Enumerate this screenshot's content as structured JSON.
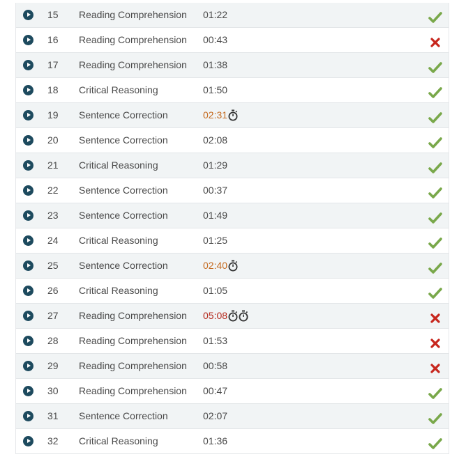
{
  "colors": {
    "correct": "#79a84a",
    "incorrect": "#c7261d",
    "time_warn": "#c56a1f",
    "time_over": "#b52a1e",
    "play_icon": "#1d4a5e"
  },
  "rows": [
    {
      "num": "15",
      "category": "Reading Comprehension",
      "time": "01:22",
      "time_status": "normal",
      "timers": 0,
      "result": "correct"
    },
    {
      "num": "16",
      "category": "Reading Comprehension",
      "time": "00:43",
      "time_status": "normal",
      "timers": 0,
      "result": "incorrect"
    },
    {
      "num": "17",
      "category": "Reading Comprehension",
      "time": "01:38",
      "time_status": "normal",
      "timers": 0,
      "result": "correct"
    },
    {
      "num": "18",
      "category": "Critical Reasoning",
      "time": "01:50",
      "time_status": "normal",
      "timers": 0,
      "result": "correct"
    },
    {
      "num": "19",
      "category": "Sentence Correction",
      "time": "02:31",
      "time_status": "warn",
      "timers": 1,
      "result": "correct"
    },
    {
      "num": "20",
      "category": "Sentence Correction",
      "time": "02:08",
      "time_status": "normal",
      "timers": 0,
      "result": "correct"
    },
    {
      "num": "21",
      "category": "Critical Reasoning",
      "time": "01:29",
      "time_status": "normal",
      "timers": 0,
      "result": "correct"
    },
    {
      "num": "22",
      "category": "Sentence Correction",
      "time": "00:37",
      "time_status": "normal",
      "timers": 0,
      "result": "correct"
    },
    {
      "num": "23",
      "category": "Sentence Correction",
      "time": "01:49",
      "time_status": "normal",
      "timers": 0,
      "result": "correct"
    },
    {
      "num": "24",
      "category": "Critical Reasoning",
      "time": "01:25",
      "time_status": "normal",
      "timers": 0,
      "result": "correct"
    },
    {
      "num": "25",
      "category": "Sentence Correction",
      "time": "02:40",
      "time_status": "warn",
      "timers": 1,
      "result": "correct"
    },
    {
      "num": "26",
      "category": "Critical Reasoning",
      "time": "01:05",
      "time_status": "normal",
      "timers": 0,
      "result": "correct"
    },
    {
      "num": "27",
      "category": "Reading Comprehension",
      "time": "05:08",
      "time_status": "over",
      "timers": 2,
      "result": "incorrect"
    },
    {
      "num": "28",
      "category": "Reading Comprehension",
      "time": "01:53",
      "time_status": "normal",
      "timers": 0,
      "result": "incorrect"
    },
    {
      "num": "29",
      "category": "Reading Comprehension",
      "time": "00:58",
      "time_status": "normal",
      "timers": 0,
      "result": "incorrect"
    },
    {
      "num": "30",
      "category": "Reading Comprehension",
      "time": "00:47",
      "time_status": "normal",
      "timers": 0,
      "result": "correct"
    },
    {
      "num": "31",
      "category": "Sentence Correction",
      "time": "02:07",
      "time_status": "normal",
      "timers": 0,
      "result": "correct"
    },
    {
      "num": "32",
      "category": "Critical Reasoning",
      "time": "01:36",
      "time_status": "normal",
      "timers": 0,
      "result": "correct"
    }
  ]
}
